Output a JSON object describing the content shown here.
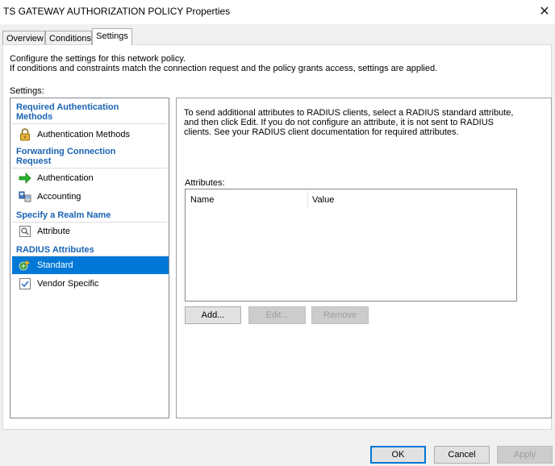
{
  "window": {
    "title": "TS GATEWAY AUTHORIZATION POLICY Properties",
    "close": "✕"
  },
  "tabs": [
    {
      "label": "Overview"
    },
    {
      "label": "Conditions"
    },
    {
      "label": "Settings"
    }
  ],
  "description": {
    "line1": "Configure the settings for this network policy.",
    "line2": "If conditions and constraints match the connection request and the policy grants access, settings are applied."
  },
  "settings_label": "Settings:",
  "nav": {
    "sections": [
      {
        "heading": "Required Authentication Methods",
        "items": [
          {
            "label": "Authentication Methods",
            "icon": "lock-icon"
          }
        ]
      },
      {
        "heading": "Forwarding Connection Request",
        "items": [
          {
            "label": "Authentication",
            "icon": "green-arrow-icon"
          },
          {
            "label": "Accounting",
            "icon": "accounting-icon"
          }
        ]
      },
      {
        "heading": "Specify a Realm Name",
        "items": [
          {
            "label": "Attribute",
            "icon": "attribute-icon"
          }
        ]
      },
      {
        "heading": "RADIUS Attributes",
        "items": [
          {
            "label": "Standard",
            "icon": "standard-icon"
          },
          {
            "label": "Vendor Specific",
            "icon": "vendor-specific-icon"
          }
        ]
      }
    ],
    "selected": "Standard"
  },
  "right_panel": {
    "text": "To send additional attributes to RADIUS clients, select a RADIUS standard attribute, and then click Edit. If you do not configure an attribute, it is not sent to RADIUS clients. See your RADIUS client documentation for required attributes.",
    "attributes_label": "Attributes:",
    "columns": [
      "Name",
      "Value"
    ],
    "buttons": {
      "add": "Add...",
      "edit": "Edit...",
      "remove": "Remove"
    }
  },
  "footer": {
    "ok": "OK",
    "cancel": "Cancel",
    "apply": "Apply"
  }
}
